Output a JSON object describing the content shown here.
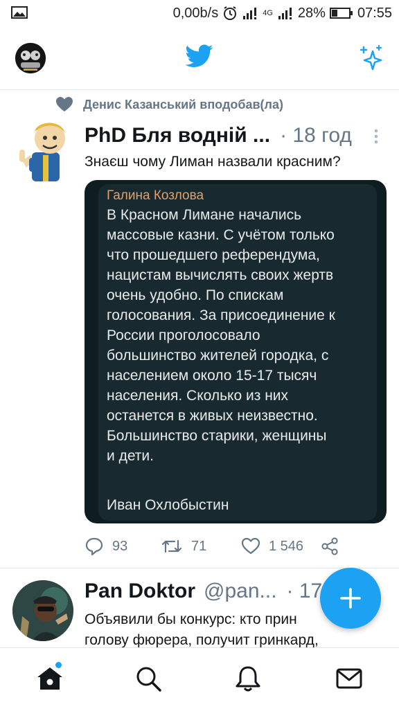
{
  "status_bar": {
    "network_speed": "0,00b/s",
    "signal_label": "4G",
    "battery": "28%",
    "time": "07:55"
  },
  "header": {
    "brand": "twitter-bird-icon",
    "accent_color": "#1da1f2"
  },
  "timeline": [
    {
      "social_context": "Денис Казанський вподобав(ла)",
      "author_name": "PhD Бля водній ...",
      "time": "· 18 год",
      "text": "Знаєш чому Лиман назвали красним?",
      "media": {
        "message_author": "Галина Козлова",
        "message_lines": [
          "В Красном Лимане начались",
          "массовые казни. С учётом только",
          "что прошедшего референдума,",
          "нацистам вычислять своих жертв",
          "очень удобно. По спискам",
          "голосования. За присоединение к",
          "России проголосовало",
          "большинство жителей городка, с",
          "населением около 15-17 тысяч",
          "населения. Сколько из них",
          "останется в живых неизвестно.",
          "Большинство старики, женщины",
          "и дети."
        ],
        "signature": "Иван Охлобыстин"
      },
      "actions": {
        "replies": "93",
        "retweets": "71",
        "likes": "1 546"
      }
    },
    {
      "author_name": "Pan Doktor",
      "handle": "@pan...",
      "time": "· 17",
      "text_lines": [
        "Объявили бы конкурс: кто прин",
        "голову фюрера, получит гринкард,"
      ]
    }
  ],
  "bottom_nav": [
    "home-icon",
    "search-icon",
    "notifications-icon",
    "messages-icon"
  ]
}
